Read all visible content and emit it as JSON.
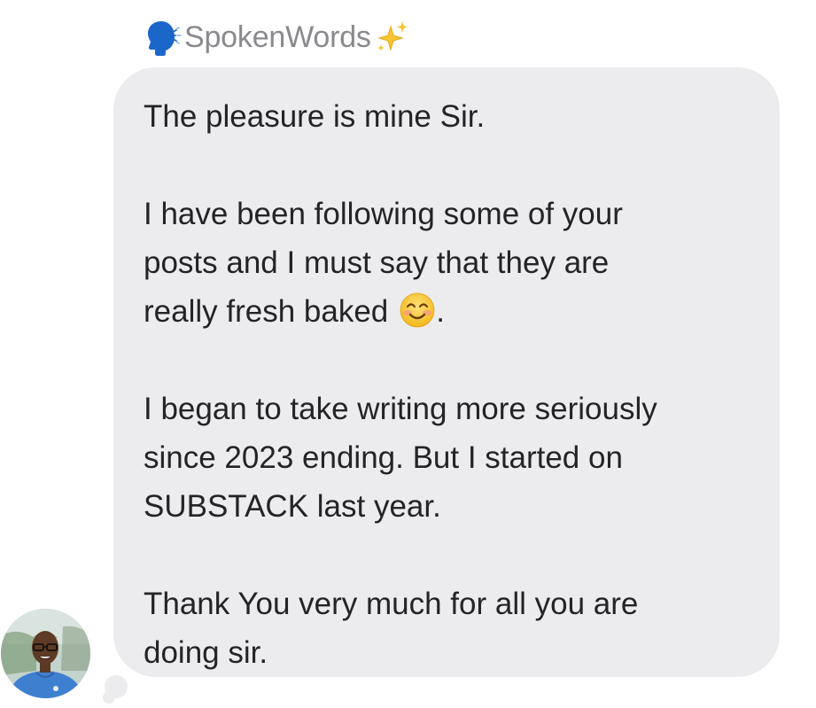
{
  "message": {
    "sender_name": "SpokenWords",
    "sender_prefix_icon": "speaking-head-emoji",
    "sender_suffix_icon": "sparkles-emoji",
    "paragraphs": [
      {
        "text": "The pleasure is mine Sir."
      },
      {
        "text": "I have been following some of your\nposts and I must say that they are\nreally fresh baked",
        "trailing_emoji": "smiling-face-emoji",
        "trailing_text": "."
      },
      {
        "text": "I began to take writing more seriously\nsince 2023 ending. But I started on\nSUBSTACK last year."
      },
      {
        "text": "Thank You very much for all you are\ndoing sir."
      }
    ],
    "bubble_color": "#ececef",
    "text_color": "#242426"
  },
  "avatar": {
    "description_icon": "sender-avatar"
  }
}
